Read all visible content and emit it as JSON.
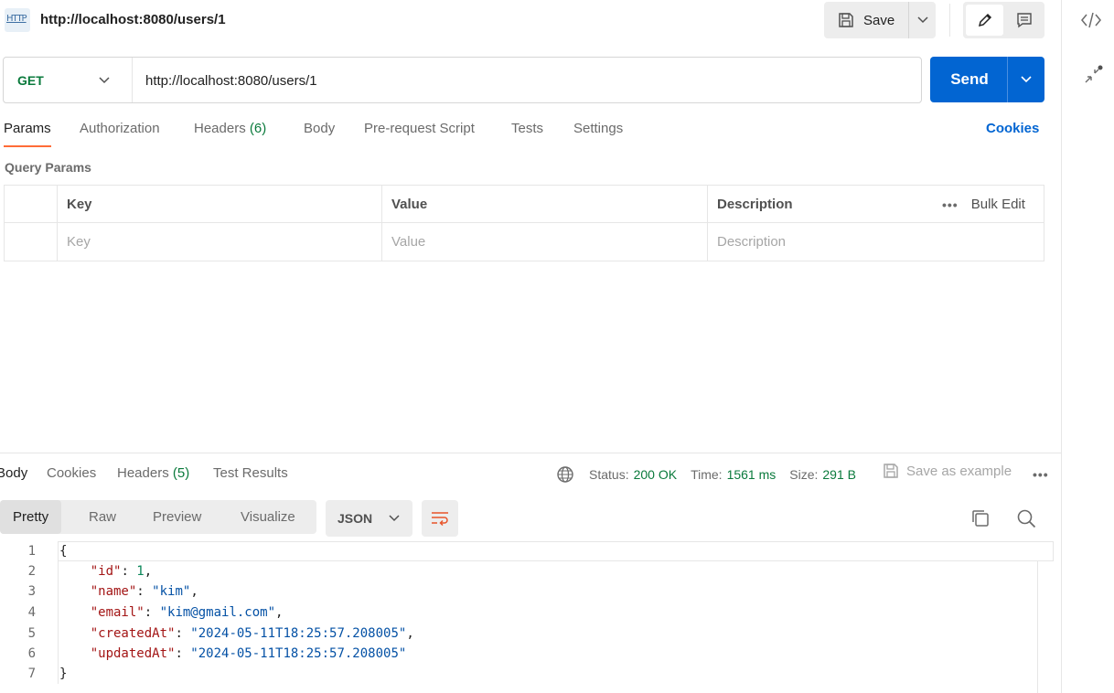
{
  "tab": {
    "title": "http://localhost:8080/users/1",
    "badge": "HTTP"
  },
  "toolbar": {
    "save_label": "Save"
  },
  "request": {
    "method": "GET",
    "url": "http://localhost:8080/users/1",
    "send_label": "Send",
    "tabs": [
      {
        "label": "Params",
        "count": ""
      },
      {
        "label": "Authorization",
        "count": ""
      },
      {
        "label": "Headers",
        "count": "(6)"
      },
      {
        "label": "Body",
        "count": ""
      },
      {
        "label": "Pre-request Script",
        "count": ""
      },
      {
        "label": "Tests",
        "count": ""
      },
      {
        "label": "Settings",
        "count": ""
      }
    ],
    "cookies_label": "Cookies"
  },
  "query_params": {
    "title": "Query Params",
    "headers": {
      "key": "Key",
      "value": "Value",
      "description": "Description",
      "bulk_edit": "Bulk Edit"
    },
    "placeholders": {
      "key": "Key",
      "value": "Value",
      "description": "Description"
    }
  },
  "response": {
    "tabs": [
      {
        "label": "Body",
        "count": ""
      },
      {
        "label": "Cookies",
        "count": ""
      },
      {
        "label": "Headers",
        "count": "(5)"
      },
      {
        "label": "Test Results",
        "count": ""
      }
    ],
    "status_label": "Status:",
    "status_value": "200 OK",
    "time_label": "Time:",
    "time_value": "1561 ms",
    "size_label": "Size:",
    "size_value": "291 B",
    "save_example": "Save as example",
    "views": [
      "Pretty",
      "Raw",
      "Preview",
      "Visualize"
    ],
    "format": "JSON",
    "code_lines": [
      {
        "n": "1",
        "text": "{"
      },
      {
        "n": "2",
        "key": "\"id\"",
        "value": "1",
        "value_type": "number",
        "comma": ","
      },
      {
        "n": "3",
        "key": "\"name\"",
        "value": "\"kim\"",
        "value_type": "string",
        "comma": ","
      },
      {
        "n": "4",
        "key": "\"email\"",
        "value": "\"kim@gmail.com\"",
        "value_type": "string",
        "comma": ","
      },
      {
        "n": "5",
        "key": "\"createdAt\"",
        "value": "\"2024-05-11T18:25:57.208005\"",
        "value_type": "string",
        "comma": ","
      },
      {
        "n": "6",
        "key": "\"updatedAt\"",
        "value": "\"2024-05-11T18:25:57.208005\"",
        "value_type": "string",
        "comma": ""
      },
      {
        "n": "7",
        "text": "}"
      }
    ]
  },
  "colors": {
    "send_blue": "#0265d2",
    "success_green": "#0a7a3c",
    "active_tab_underline": "#ff6c37",
    "wrap_icon_orange": "#e8542a"
  },
  "icons": [
    "http-icon",
    "save-icon",
    "chevron-down-icon",
    "pencil-icon",
    "comment-icon",
    "code-icon",
    "collapse-icon",
    "globe-icon",
    "wrap-lines-icon",
    "copy-icon",
    "search-icon",
    "more-icon"
  ]
}
